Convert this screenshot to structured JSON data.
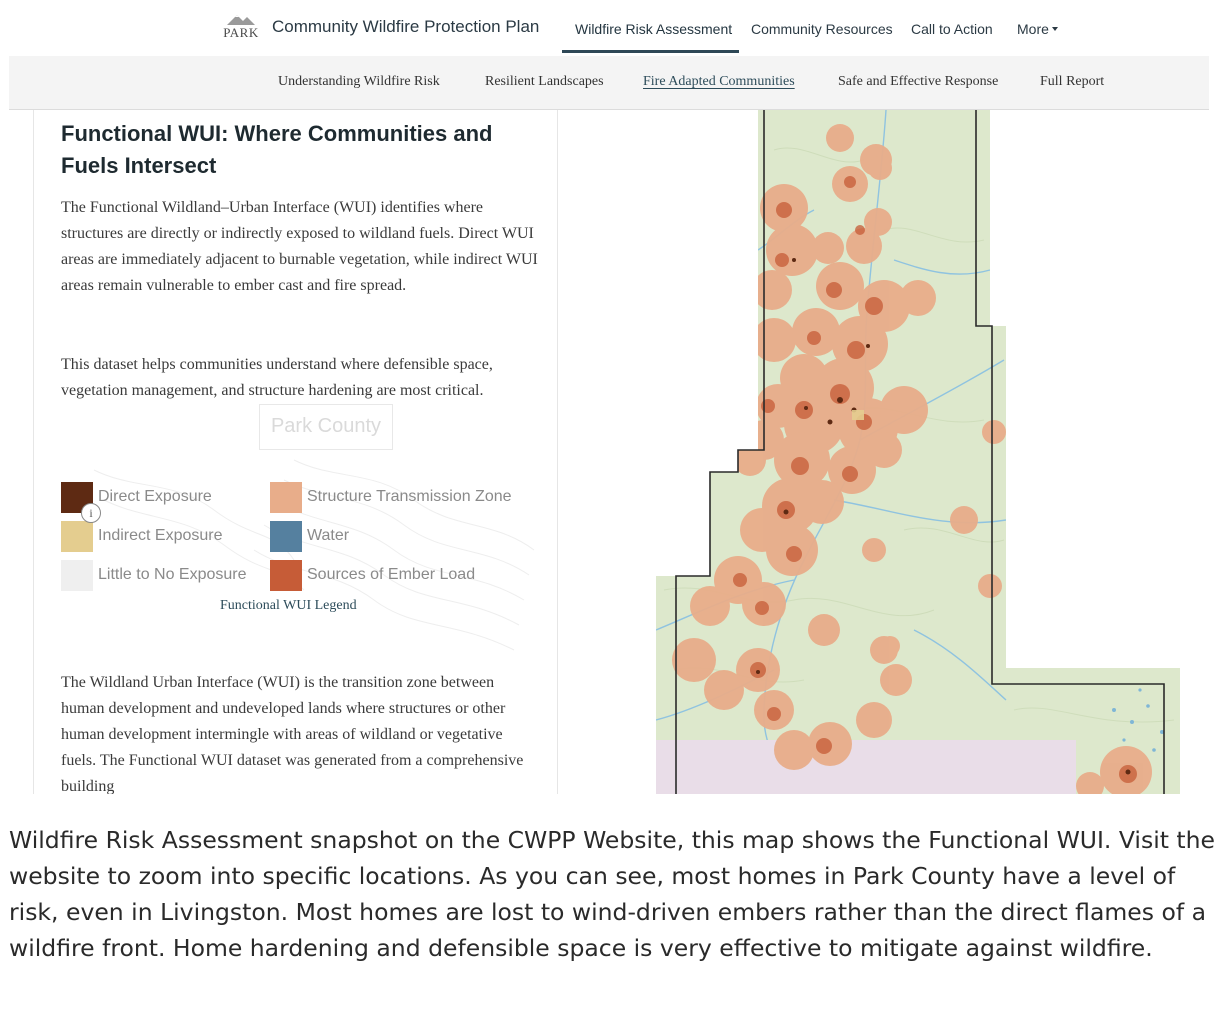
{
  "header": {
    "logo_text": "PARK",
    "site_title": "Community Wildfire Protection Plan",
    "nav": [
      {
        "label": "Wildfire Risk Assessment",
        "active": true
      },
      {
        "label": "Community Resources"
      },
      {
        "label": "Call to Action"
      },
      {
        "label": "More"
      }
    ]
  },
  "subnav": [
    {
      "label": "Understanding Wildfire Risk"
    },
    {
      "label": "Resilient Landscapes"
    },
    {
      "label": "Fire Adapted Communities",
      "active": true
    },
    {
      "label": "Safe and Effective Response"
    },
    {
      "label": "Full Report"
    }
  ],
  "content": {
    "title": "Functional WUI: Where Communities and Fuels Intersect",
    "paragraph1": "The Functional Wildland–Urban Interface (WUI) identifies where structures are directly or indirectly exposed to wildland fuels. Direct WUI areas are immediately adjacent to burnable vegetation, while indirect WUI areas remain vulnerable to ember cast and fire spread.",
    "paragraph2": "This dataset helps communities understand where defensible space, vegetation management, and structure hardening are most critical.",
    "watermark": "Park County",
    "legend": {
      "items": [
        {
          "label": "Direct Exposure",
          "color": "#5e2a13"
        },
        {
          "label": "Indirect Exposure",
          "color": "#e4cd8f"
        },
        {
          "label": "Little to No Exposure",
          "color": "#efefef"
        },
        {
          "label": "Structure Transmission Zone",
          "color": "#e8ad8a"
        },
        {
          "label": "Water",
          "color": "#55809f"
        },
        {
          "label": "Sources of Ember Load",
          "color": "#c65c37"
        }
      ],
      "info": "i",
      "caption": "Functional WUI Legend"
    },
    "paragraph3": "The Wildland Urban Interface (WUI) is the transition zone between human development and undeveloped lands where structures or other human development intermingle with areas of wildland or vegetative fuels. The Functional WUI dataset was generated from a comprehensive building"
  },
  "map": {
    "colors": {
      "terrain": "#dde8cc",
      "transmission": "#e8ad8a",
      "ember": "#c65c37",
      "direct": "#5e2a13",
      "water": "#7fb6d6",
      "boundary": "#2a2a2a",
      "south": "#e9dde8"
    }
  },
  "caption": "Wildfire Risk Assessment snapshot on the CWPP Website, this map shows the Functional WUI. Visit the website to zoom into specific locations. As you can see, most homes in Park County have a level of risk, even in Livingston. Most homes are lost to wind-driven embers rather than the direct flames of a wildfire front. Home hardening and defensible space is very effective to mitigate against wildfire."
}
